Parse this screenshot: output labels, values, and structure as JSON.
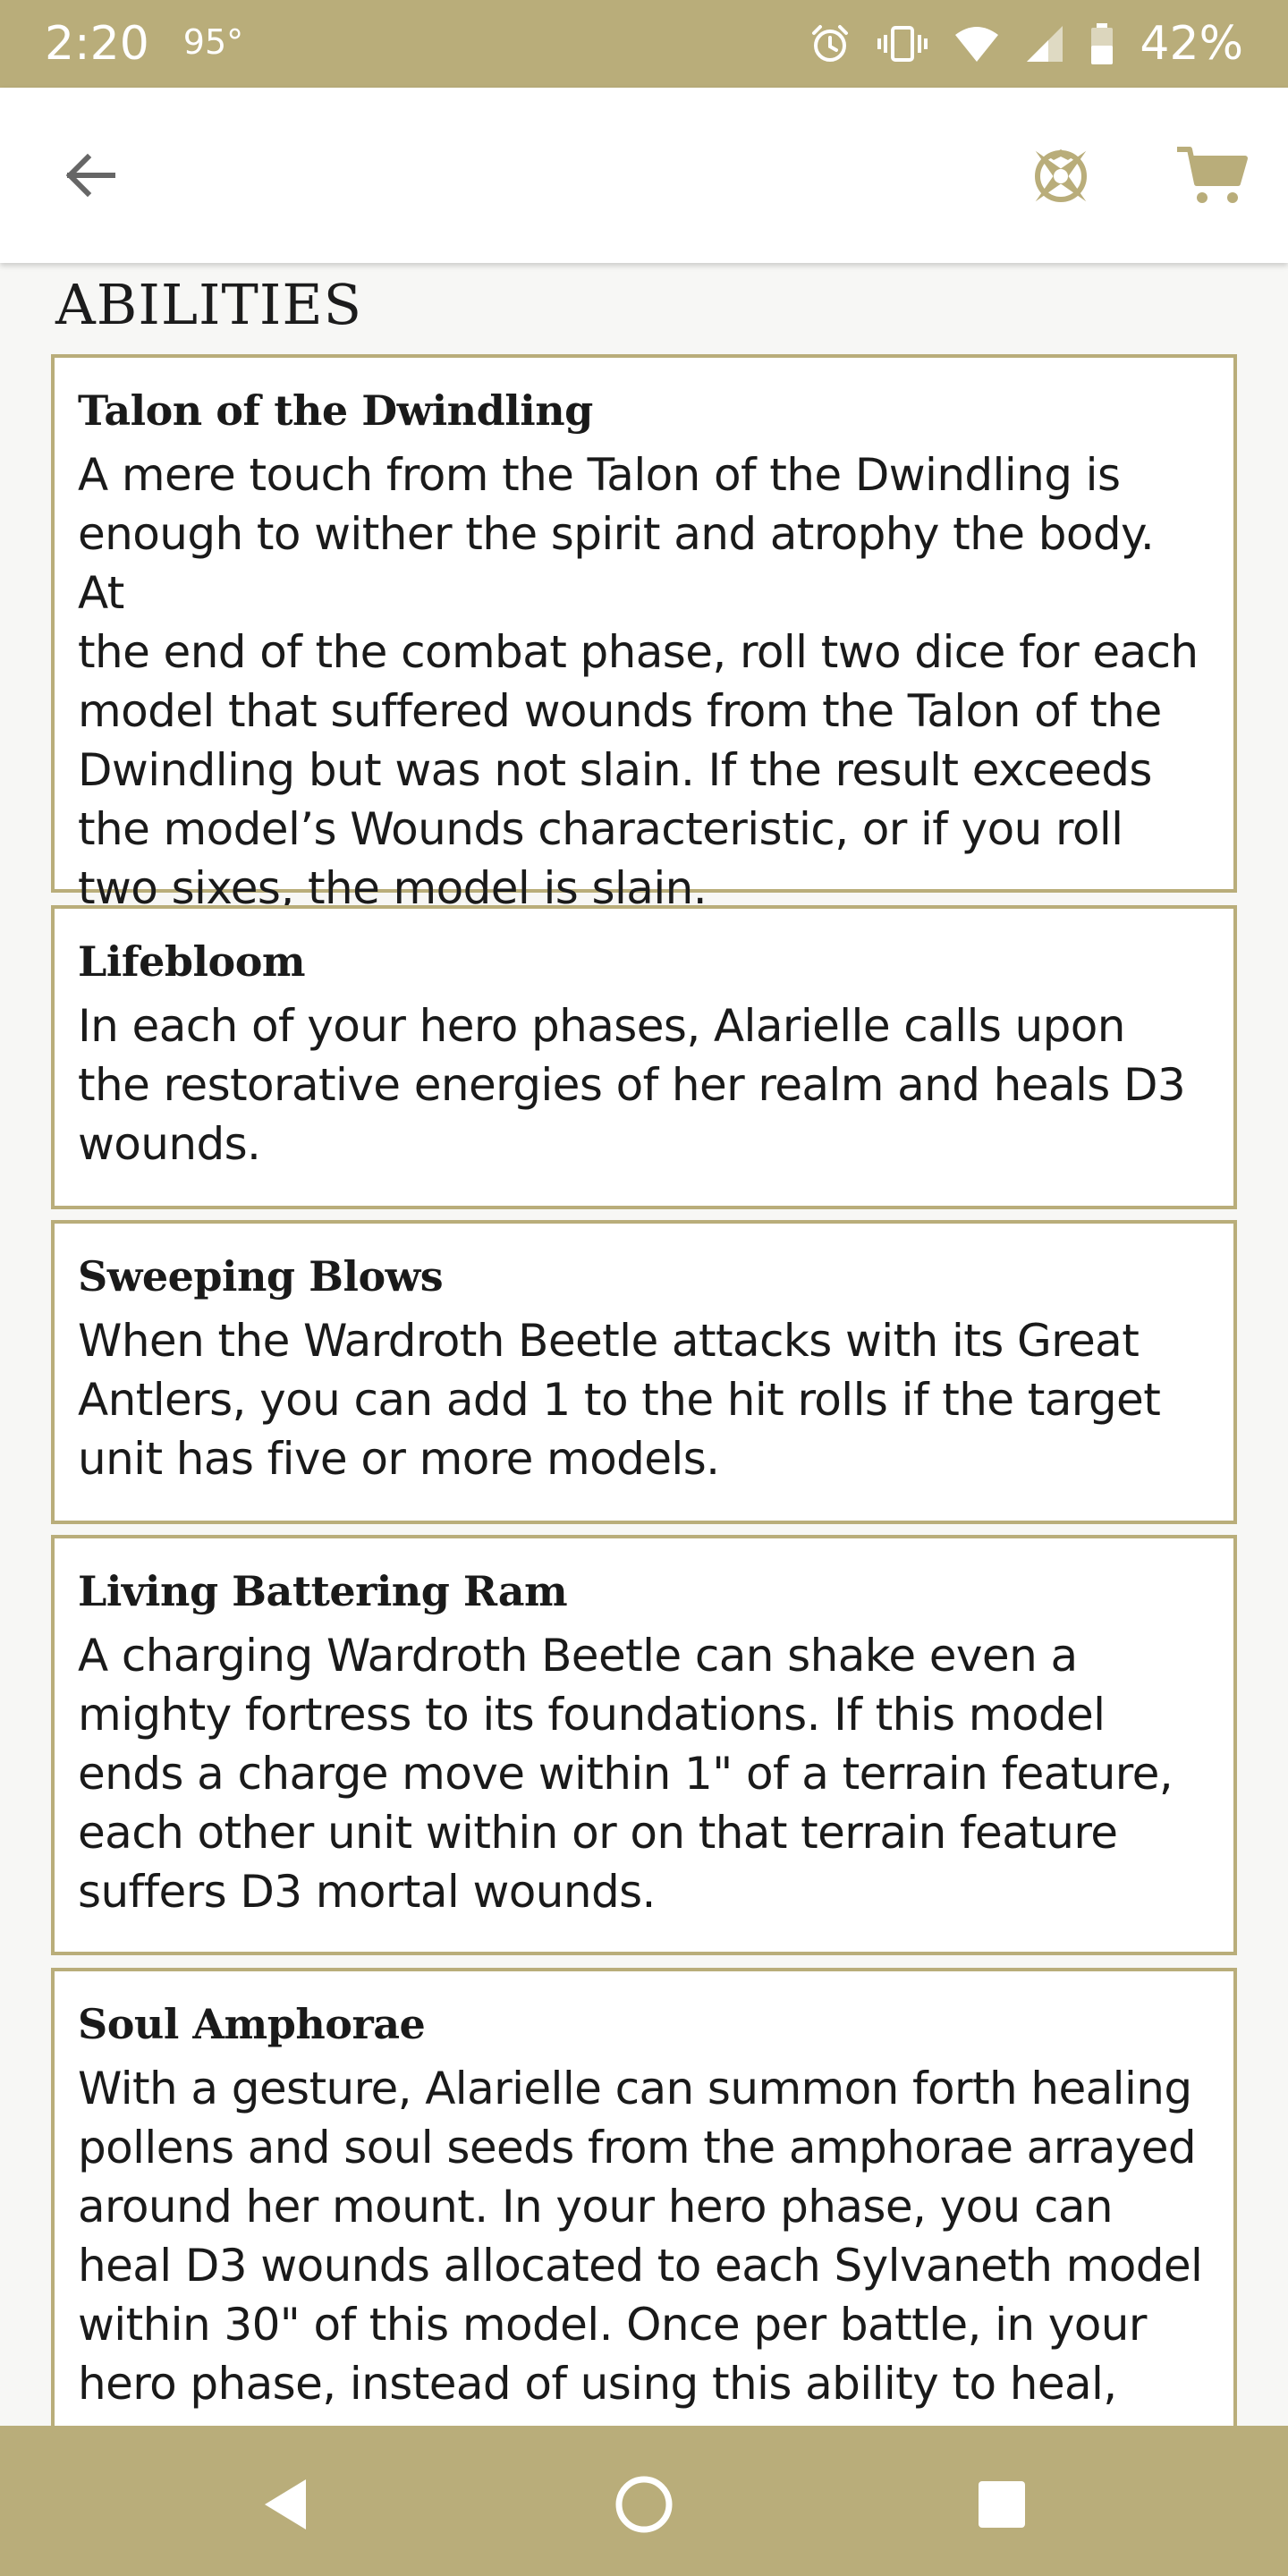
{
  "status_bar": {
    "time": "2:20",
    "temperature": "95°",
    "battery": "42%",
    "icons": [
      "alarm-icon",
      "vibrate-icon",
      "wifi-icon",
      "signal-icon",
      "battery-icon"
    ]
  },
  "app_bar": {
    "icons": [
      "arrow-left-icon",
      "compass-icon",
      "cart-icon"
    ]
  },
  "colors": {
    "accent": "#b9ad7a",
    "accent_dark": "#a8995a",
    "background": "#f7f7f5",
    "text": "#1a1a1a"
  },
  "content": {
    "section_title": "ABILITIES",
    "abilities": [
      {
        "name": "Talon of the Dwindling",
        "lines": [
          "A mere touch from the Talon of the Dwindling is",
          "enough to wither the spirit and atrophy the body. At",
          "the end of the combat phase, roll two dice for each",
          "model that suffered wounds from the Talon of the",
          "Dwindling but was not slain. If the result exceeds",
          "the model’s Wounds characteristic, or if you roll",
          "two sixes, the model is slain."
        ]
      },
      {
        "name": "Lifebloom",
        "lines": [
          "In each of your hero phases, Alarielle calls upon",
          "the restorative energies of her realm and heals D3",
          "wounds."
        ]
      },
      {
        "name": "Sweeping Blows",
        "lines": [
          "When the Wardroth Beetle attacks with its Great",
          "Antlers, you can add 1 to the hit rolls if the target",
          "unit has five or more models."
        ]
      },
      {
        "name": "Living Battering Ram",
        "lines": [
          "A charging Wardroth Beetle can shake even a",
          "mighty fortress to its foundations. If this model",
          "ends a charge move within 1\" of a terrain feature,",
          "each other unit within or on that terrain feature",
          "suffers D3 mortal wounds."
        ]
      },
      {
        "name": "Soul Amphorae",
        "lines": [
          "With a gesture, Alarielle can summon forth healing",
          "pollens and soul seeds from the amphorae arrayed",
          "around her mount. In your hero phase, you can",
          "heal D3 wounds allocated to each Sylvaneth model",
          "within 30\" of this model. Once per battle, in your",
          "hero phase, instead of using this ability to heal,"
        ]
      }
    ]
  },
  "nav_bar": {
    "icons": [
      "nav-back-icon",
      "nav-home-icon",
      "nav-recent-icon"
    ]
  }
}
